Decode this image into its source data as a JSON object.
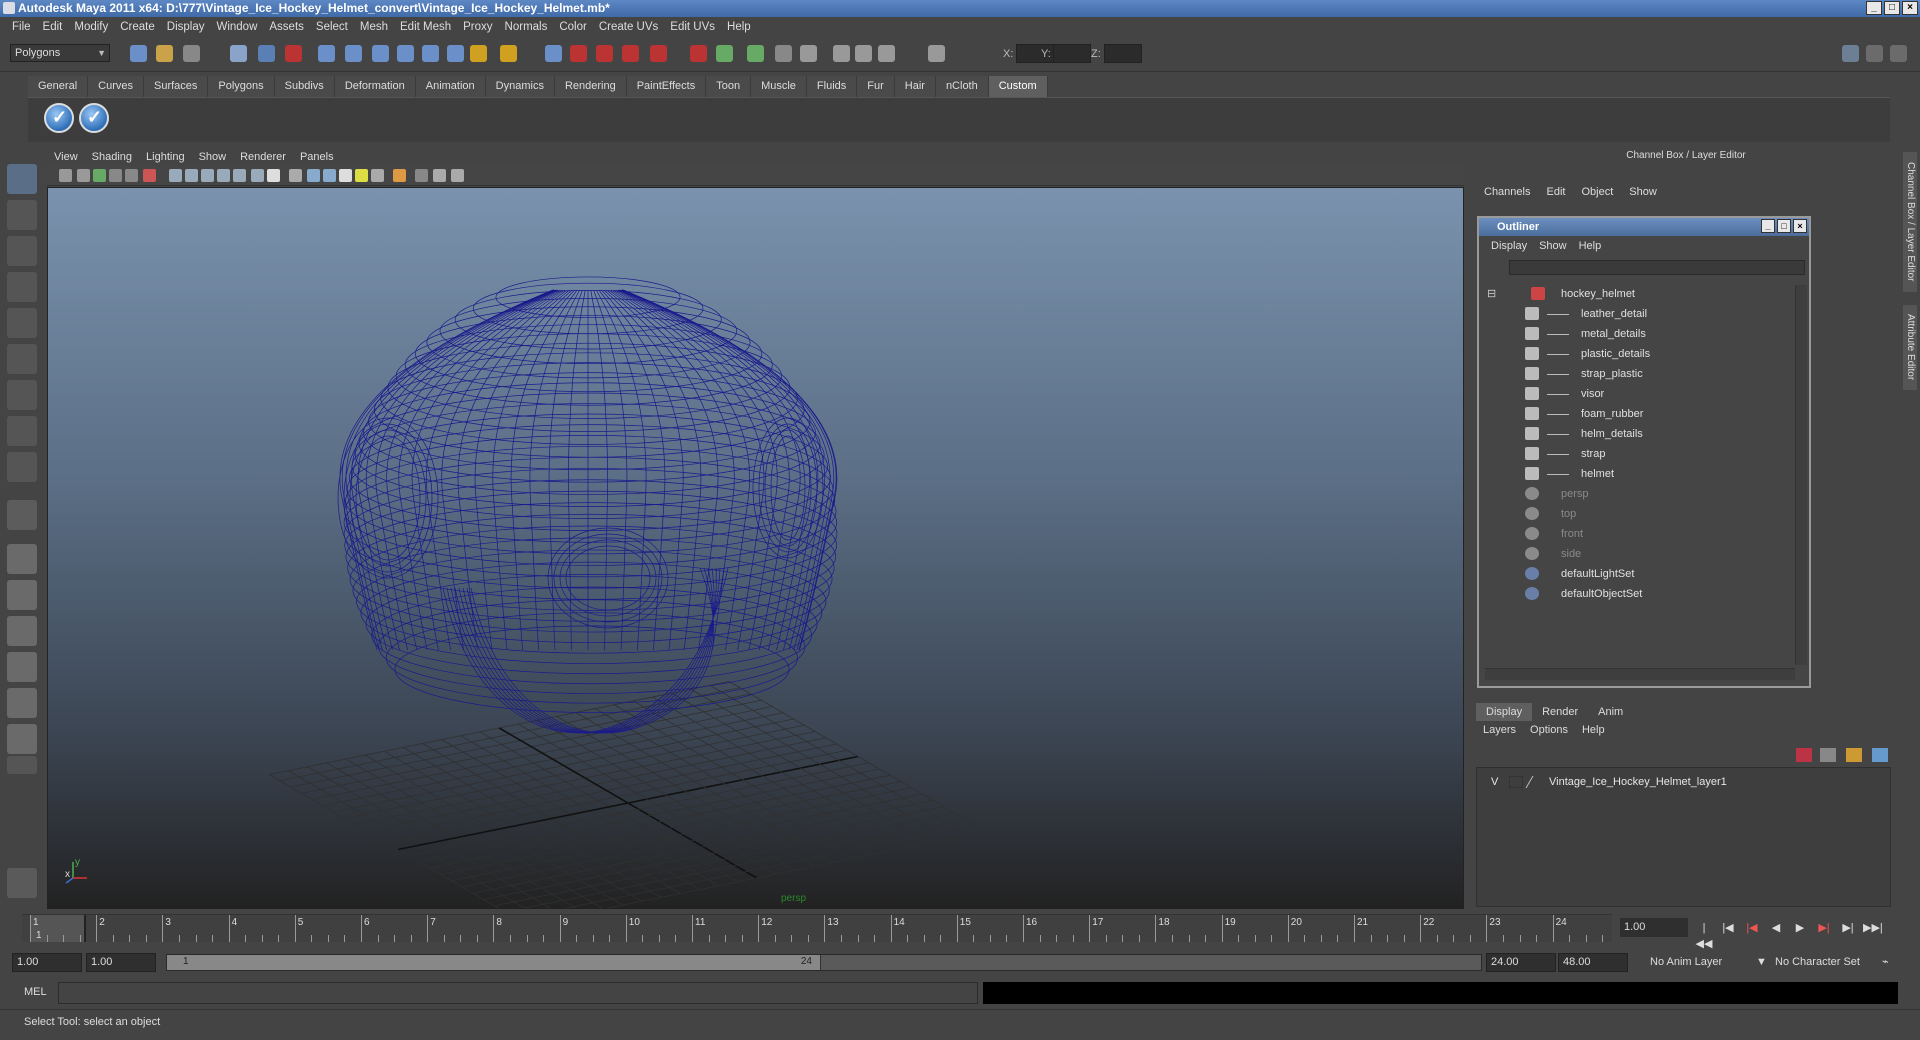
{
  "window": {
    "title": "Autodesk Maya 2011 x64: D:\\777\\Vintage_Ice_Hockey_Helmet_convert\\Vintage_Ice_Hockey_Helmet.mb*"
  },
  "menubar": [
    "File",
    "Edit",
    "Modify",
    "Create",
    "Display",
    "Window",
    "Assets",
    "Select",
    "Mesh",
    "Edit Mesh",
    "Proxy",
    "Normals",
    "Color",
    "Create UVs",
    "Edit UVs",
    "Help"
  ],
  "status_line": {
    "mode": "Polygons",
    "x_label": "X:",
    "y_label": "Y:",
    "z_label": "Z:"
  },
  "shelf": {
    "tabs": [
      "General",
      "Curves",
      "Surfaces",
      "Polygons",
      "Subdivs",
      "Deformation",
      "Animation",
      "Dynamics",
      "Rendering",
      "PaintEffects",
      "Toon",
      "Muscle",
      "Fluids",
      "Fur",
      "Hair",
      "nCloth",
      "Custom"
    ],
    "active_tab": "Custom"
  },
  "viewport": {
    "menu": [
      "View",
      "Shading",
      "Lighting",
      "Show",
      "Renderer",
      "Panels"
    ],
    "camera_label": "persp",
    "axis": {
      "x": "x",
      "y": "y"
    },
    "wire_color": "#1a1a8c"
  },
  "channel_box": {
    "title": "Channel Box / Layer Editor",
    "menu": [
      "Channels",
      "Edit",
      "Object",
      "Show"
    ]
  },
  "outliner": {
    "title": "Outliner",
    "menu": [
      "Display",
      "Show",
      "Help"
    ],
    "items": [
      {
        "label": "hockey_helmet",
        "dim": false
      },
      {
        "label": "leather_detail",
        "dim": false
      },
      {
        "label": "metal_details",
        "dim": false
      },
      {
        "label": "plastic_details",
        "dim": false
      },
      {
        "label": "strap_plastic",
        "dim": false
      },
      {
        "label": "visor",
        "dim": false
      },
      {
        "label": "foam_rubber",
        "dim": false
      },
      {
        "label": "helm_details",
        "dim": false
      },
      {
        "label": "strap",
        "dim": false
      },
      {
        "label": "helmet",
        "dim": false
      },
      {
        "label": "persp",
        "dim": true
      },
      {
        "label": "top",
        "dim": true
      },
      {
        "label": "front",
        "dim": true
      },
      {
        "label": "side",
        "dim": true
      },
      {
        "label": "defaultLightSet",
        "dim": false
      },
      {
        "label": "defaultObjectSet",
        "dim": false
      }
    ]
  },
  "layer_editor": {
    "tabs": [
      "Display",
      "Render",
      "Anim"
    ],
    "active_tab": "Display",
    "menu": [
      "Layers",
      "Options",
      "Help"
    ],
    "layers": [
      {
        "visible": "V",
        "name": "Vintage_Ice_Hockey_Helmet_layer1"
      }
    ]
  },
  "side_tabs": [
    "Channel Box / Layer Editor",
    "Attribute Editor"
  ],
  "timeline": {
    "ticks": [
      "1",
      "2",
      "3",
      "4",
      "5",
      "6",
      "7",
      "8",
      "9",
      "10",
      "11",
      "12",
      "13",
      "14",
      "15",
      "16",
      "17",
      "18",
      "19",
      "20",
      "21",
      "22",
      "23",
      "24"
    ],
    "current_marker": "1",
    "current_frame": "1.00"
  },
  "range": {
    "start": "1.00",
    "start_inner": "1.00",
    "slider_start": "1",
    "slider_end": "24",
    "end_inner": "24.00",
    "end": "48.00",
    "anim_layer": "No Anim Layer",
    "char_set": "No Character Set"
  },
  "command_line": {
    "label": "MEL"
  },
  "help_line": {
    "text": "Select Tool: select an object"
  }
}
